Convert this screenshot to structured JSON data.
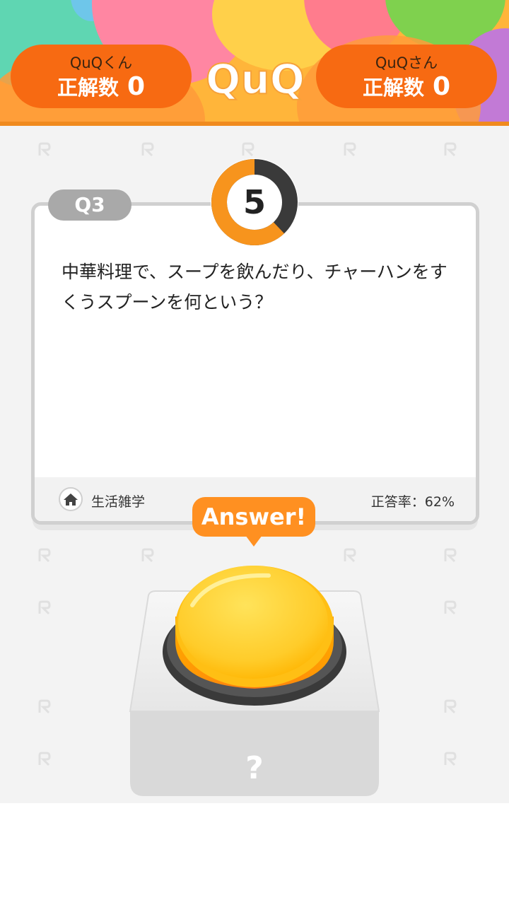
{
  "header": {
    "logo_text": "QuQ",
    "players": [
      {
        "name": "QuQくん",
        "score_label": "正解数",
        "score": "0"
      },
      {
        "name": "QuQさん",
        "score_label": "正解数",
        "score": "0"
      }
    ]
  },
  "question": {
    "number_label": "Q3",
    "timer_value": "5",
    "timer_remaining_fraction": 0.62,
    "text": "中華料理で、スープを飲んだり、チャーハンをすくうスプーンを何という？",
    "genre_icon": "home-icon",
    "genre": "生活雑学",
    "correct_rate": "正答率：62%"
  },
  "answer": {
    "bubble_label": "Answer!",
    "box_symbol": "?"
  },
  "colors": {
    "accent_orange": "#f76a12",
    "header_yellow": "#ffb53a",
    "bubble_orange": "#ff9021",
    "timer_ring_orange": "#f7941d",
    "timer_ring_dark": "#3a3a3a",
    "badge_gray": "#a9a9a9"
  }
}
